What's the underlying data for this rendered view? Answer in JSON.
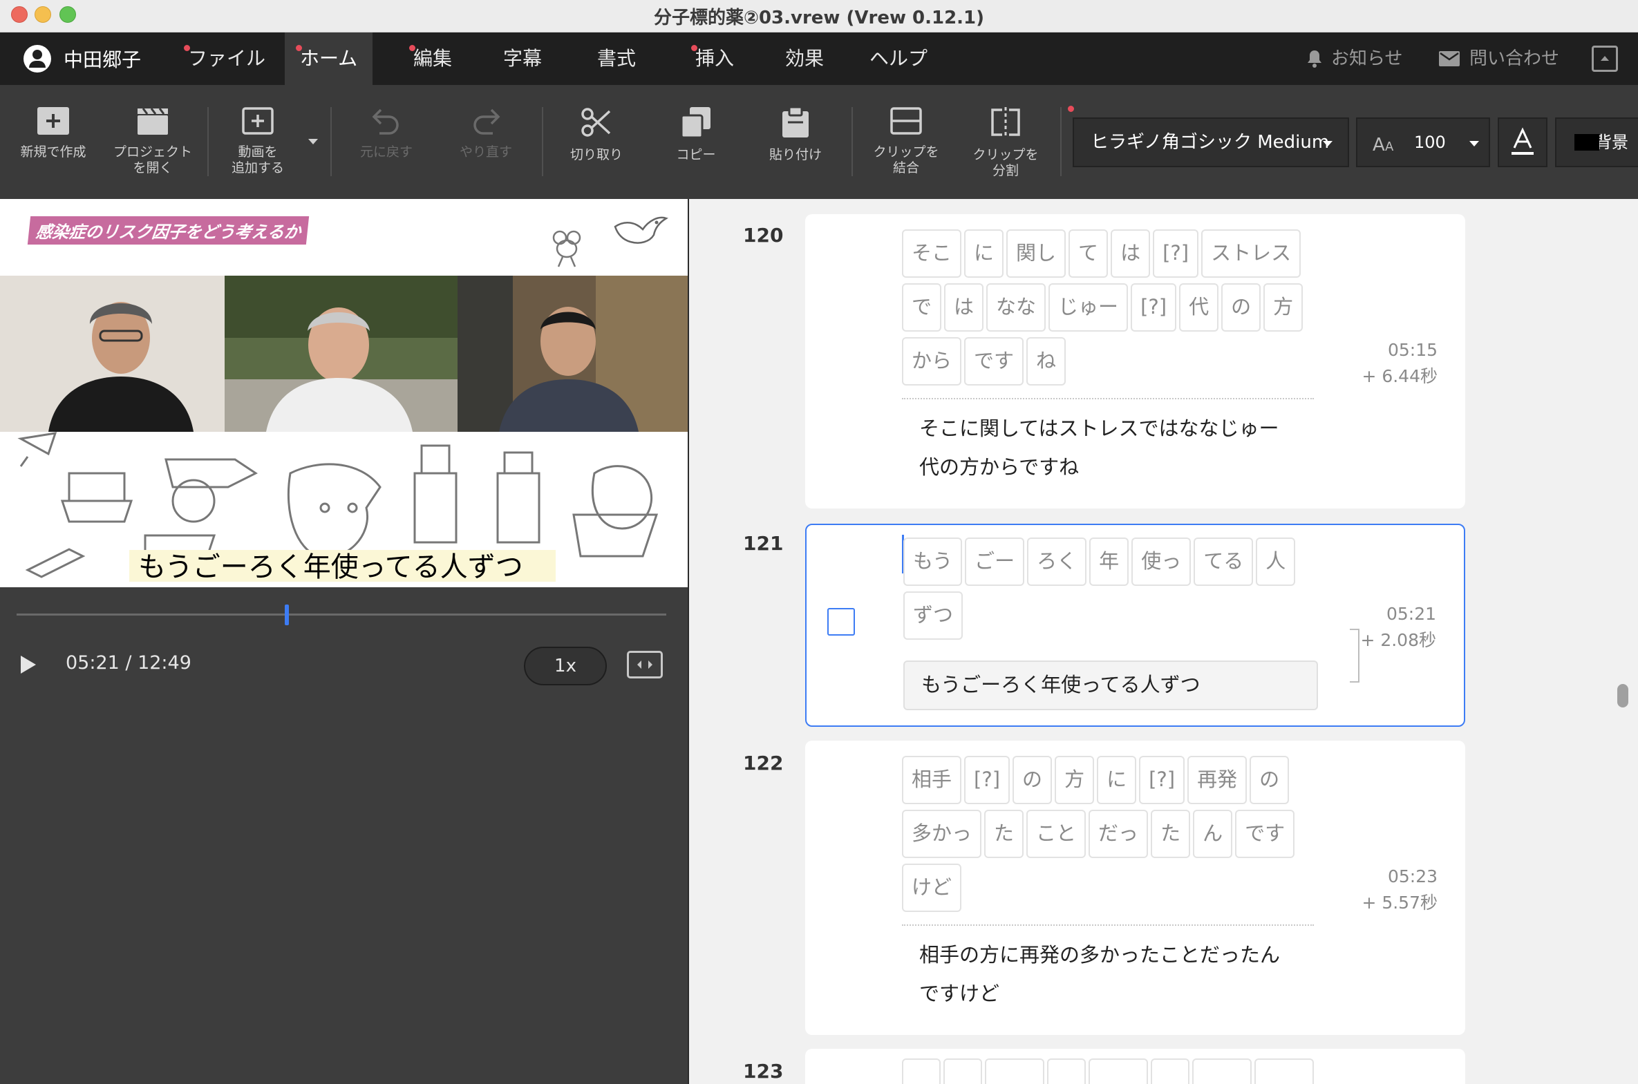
{
  "window": {
    "title": "分子標的薬②03.vrew (Vrew 0.12.1)"
  },
  "menubar": {
    "user": "中田郷子",
    "items": [
      {
        "label": "ファイル",
        "dot": true
      },
      {
        "label": "ホーム",
        "dot": true,
        "active": true
      },
      {
        "label": "編集",
        "dot": true
      },
      {
        "label": "字幕",
        "dot": false
      },
      {
        "label": "書式",
        "dot": false
      },
      {
        "label": "挿入",
        "dot": true
      },
      {
        "label": "効果",
        "dot": false
      },
      {
        "label": "ヘルプ",
        "dot": false
      }
    ],
    "notice": "お知らせ",
    "contact": "問い合わせ"
  },
  "toolbar": {
    "new": [
      "新規で作成"
    ],
    "open": [
      "プロジェクト",
      "を開く"
    ],
    "add_video": [
      "動画を",
      "追加する"
    ],
    "undo": [
      "元に戻す"
    ],
    "redo": [
      "やり直す"
    ],
    "cut": [
      "切り取り"
    ],
    "copy": [
      "コピー"
    ],
    "paste": [
      "貼り付け"
    ],
    "merge": [
      "クリップを",
      "結合"
    ],
    "split": [
      "クリップを",
      "分割"
    ],
    "font": "ヒラギノ角ゴシック Medium",
    "font_size": "100",
    "background": "背景"
  },
  "preview": {
    "title": "感染症のリスク因子をどう考えるか",
    "caption": "もうごーろく年使ってる人ずつ"
  },
  "player": {
    "time": "05:21 / 12:49",
    "speed": "1x",
    "progress_fraction": 0.416
  },
  "clips": [
    {
      "num": "120",
      "rows": [
        [
          "そこ",
          "に",
          "関し",
          "て",
          "は",
          "[?]",
          "ストレス"
        ],
        [
          "で",
          "は",
          "なな",
          "じゅー",
          "[?]",
          "代",
          "の",
          "方"
        ],
        [
          "から",
          "です",
          "ね"
        ]
      ],
      "time": "05:15",
      "duration": "+ 6.44秒",
      "subtitle": [
        "そこに関してはストレスではななじゅー",
        "代の方からですね"
      ]
    },
    {
      "num": "121",
      "rows": [
        [
          "もう",
          "ごー",
          "ろく",
          "年",
          "使っ",
          "てる",
          "人"
        ],
        [
          "ずつ"
        ]
      ],
      "time": "05:21",
      "duration": "+ 2.08秒",
      "subtitle": [
        "もうごーろく年使ってる人ずつ"
      ]
    },
    {
      "num": "122",
      "rows": [
        [
          "相手",
          "[?]",
          "の",
          "方",
          "に",
          "[?]",
          "再発",
          "の"
        ],
        [
          "多かっ",
          "た",
          "こと",
          "だっ",
          "た",
          "ん",
          "です"
        ],
        [
          "けど"
        ]
      ],
      "time": "05:23",
      "duration": "+ 5.57秒",
      "subtitle": [
        "相手の方に再発の多かったことだったん",
        "ですけど"
      ]
    },
    {
      "num": "123"
    }
  ],
  "colors": {
    "accent": "#3d7cf4",
    "menubar": "#1f1f1f",
    "toolbar": "#3a3a3a",
    "badge": "#c76b9e"
  }
}
